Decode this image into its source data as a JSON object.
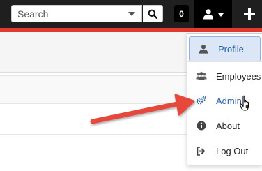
{
  "topbar": {
    "search": {
      "placeholder": "Search",
      "value": ""
    },
    "notification_count": "0"
  },
  "user_menu": {
    "items": [
      {
        "label": "Profile",
        "icon": "user-icon"
      },
      {
        "label": "Employees",
        "icon": "users-icon"
      },
      {
        "label": "Admin",
        "icon": "gears-icon"
      },
      {
        "label": "About",
        "icon": "info-circle-icon"
      },
      {
        "label": "Log Out",
        "icon": "sign-out-icon"
      }
    ]
  },
  "colors": {
    "topbar": "#1f1f1f",
    "accent_stripe": "#e03b2e",
    "highlight_bg": "#dbe7f6",
    "link_blue": "#2b62a8",
    "annotation_arrow": "#e6493a"
  }
}
